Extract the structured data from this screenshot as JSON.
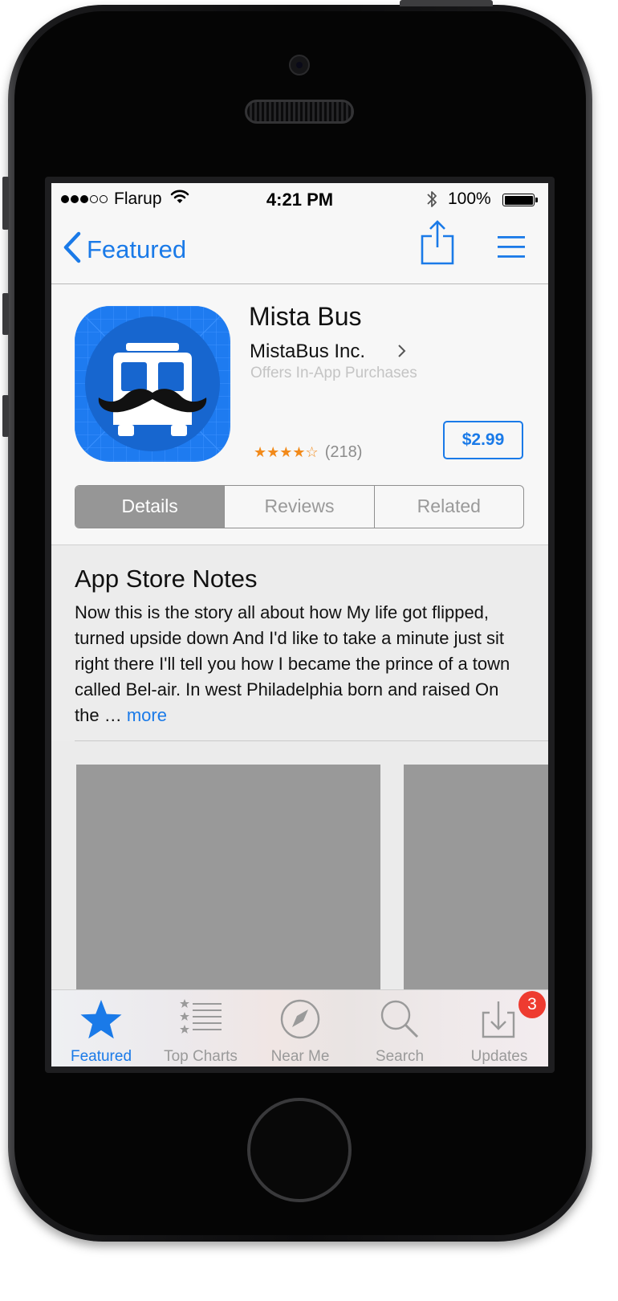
{
  "status_bar": {
    "carrier": "Flarup",
    "time": "4:21 PM",
    "battery_percent": "100%",
    "signal_bars_full": 3,
    "signal_bars_total": 5,
    "icons": [
      "wifi-icon",
      "bluetooth-icon",
      "battery-icon"
    ]
  },
  "nav": {
    "back_label": "Featured",
    "icons": [
      "back-chevron-icon",
      "share-icon",
      "menu-icon"
    ]
  },
  "app": {
    "name": "Mista Bus",
    "developer": "MistaBus Inc.",
    "in_app_note": "Offers In-App Purchases",
    "rating_stars": 4.5,
    "rating_stars_text": "★★★★☆",
    "rating_count": "(218)",
    "price": "$2.99",
    "icon": "mustache-bus-app-icon"
  },
  "segments": {
    "items": [
      {
        "label": "Details",
        "active": true
      },
      {
        "label": "Reviews",
        "active": false
      },
      {
        "label": "Related",
        "active": false
      }
    ]
  },
  "notes": {
    "title": "App Store Notes",
    "body": "Now this is the story all about how My life got flipped, turned upside down And I'd like to take a minute just sit right there I'll tell you how I became the prince of a town called Bel-air. In west Philadelphia born and raised On the",
    "ellipsis": " … ",
    "more_label": "more"
  },
  "tab_bar": {
    "items": [
      {
        "label": "Featured",
        "icon": "star-icon",
        "active": true
      },
      {
        "label": "Top Charts",
        "icon": "list-icon",
        "active": false
      },
      {
        "label": "Near Me",
        "icon": "compass-icon",
        "active": false
      },
      {
        "label": "Search",
        "icon": "search-icon",
        "active": false
      },
      {
        "label": "Updates",
        "icon": "download-tray-icon",
        "active": false
      }
    ],
    "updates_badge": "3"
  },
  "colors": {
    "accent": "#1a7ae8",
    "star": "#f28a1a",
    "badge": "#ee3b30",
    "app_icon_blue": "#1e7bf0"
  }
}
